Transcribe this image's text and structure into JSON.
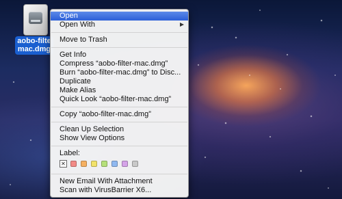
{
  "desktop": {
    "file_icon_name": "disk-image-icon",
    "file_label_line1": "aobo-filte",
    "file_label_line2": "mac.dmg"
  },
  "context_menu": {
    "items": {
      "open": "Open",
      "open_with": "Open With",
      "move_to_trash": "Move to Trash",
      "get_info": "Get Info",
      "compress": "Compress “aobo-filter-mac.dmg”",
      "burn": "Burn “aobo-filter-mac.dmg” to Disc...",
      "duplicate": "Duplicate",
      "make_alias": "Make Alias",
      "quick_look": "Quick Look “aobo-filter-mac.dmg”",
      "copy": "Copy “aobo-filter-mac.dmg”",
      "clean_up": "Clean Up Selection",
      "show_view_options": "Show View Options",
      "label_caption": "Label:",
      "new_email": "New Email With Attachment",
      "scan": "Scan with VirusBarrier X6..."
    },
    "highlighted_item": "Open",
    "label_none_glyph": "✕",
    "label_colors": [
      "#f28a86",
      "#f5b062",
      "#f2e26a",
      "#b6e07a",
      "#8fb8f0",
      "#d5a3e8",
      "#c9c9c9"
    ],
    "highlight_color": "#2c5fd8"
  }
}
